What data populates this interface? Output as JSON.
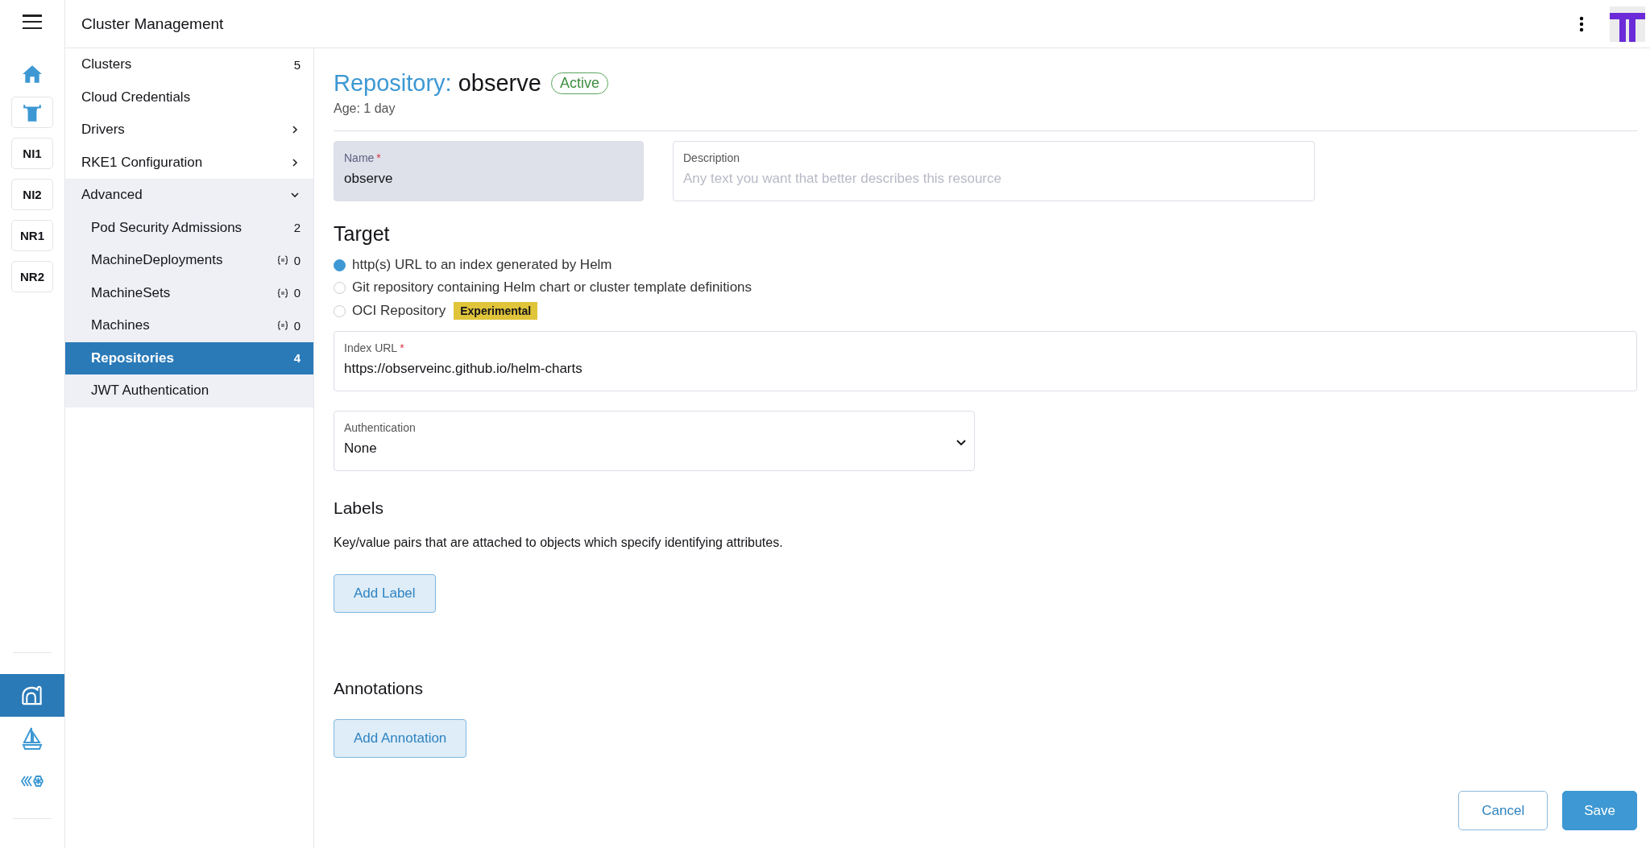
{
  "header": {
    "title": "Cluster Management"
  },
  "rail": {
    "clusters": [
      {
        "label": "NI1"
      },
      {
        "label": "NI2"
      },
      {
        "label": "NR1"
      },
      {
        "label": "NR2"
      }
    ],
    "apps": [
      {
        "kind": "tunnel",
        "selected": true
      },
      {
        "kind": "sailboat",
        "selected": false
      },
      {
        "kind": "hive",
        "selected": false
      }
    ]
  },
  "nav": [
    {
      "label": "Clusters",
      "count": "5",
      "selected": false
    },
    {
      "label": "Cloud Credentials",
      "selected": false
    },
    {
      "label": "Drivers",
      "selected": false,
      "expanded": false
    },
    {
      "label": "RKE1 Configuration",
      "selected": false,
      "expanded": false
    },
    {
      "label": "Advanced",
      "selected": false,
      "expanded": true,
      "children": [
        {
          "label": "Pod Security Admissions",
          "count": "2",
          "selected": false
        },
        {
          "label": "MachineDeployments",
          "count": "0",
          "namespaced": true,
          "selected": false
        },
        {
          "label": "MachineSets",
          "count": "0",
          "namespaced": true,
          "selected": false
        },
        {
          "label": "Machines",
          "count": "0",
          "namespaced": true,
          "selected": false
        },
        {
          "label": "Repositories",
          "count": "4",
          "selected": true
        },
        {
          "label": "JWT Authentication",
          "selected": false
        }
      ]
    }
  ],
  "page": {
    "type_label": "Repository:",
    "name": "observe",
    "status": "Active",
    "age": "Age: 1 day",
    "name_field": {
      "label": "Name",
      "required_mark": "*",
      "value": "observe",
      "disabled": true
    },
    "description_field": {
      "label": "Description",
      "placeholder": "Any text you want that better describes this resource"
    },
    "target": {
      "heading": "Target",
      "options": [
        {
          "label": "http(s) URL to an index generated by Helm",
          "selected": true
        },
        {
          "label": "Git repository containing Helm chart or cluster template definitions",
          "selected": false
        },
        {
          "label": "OCI Repository",
          "badge": "Experimental",
          "selected": false
        }
      ]
    },
    "index_url": {
      "label": "Index URL",
      "required_mark": "*",
      "value": "https://observeinc.github.io/helm-charts"
    },
    "authentication": {
      "label": "Authentication",
      "value": "None"
    },
    "labels": {
      "heading": "Labels",
      "description": "Key/value pairs that are attached to objects which specify identifying attributes.",
      "button": "Add Label"
    },
    "annotations": {
      "heading": "Annotations",
      "button": "Add Annotation"
    }
  },
  "footer": {
    "buttons": [
      {
        "label": "Cancel",
        "kind": "secondary"
      },
      {
        "label": "Save",
        "kind": "primary"
      }
    ]
  }
}
